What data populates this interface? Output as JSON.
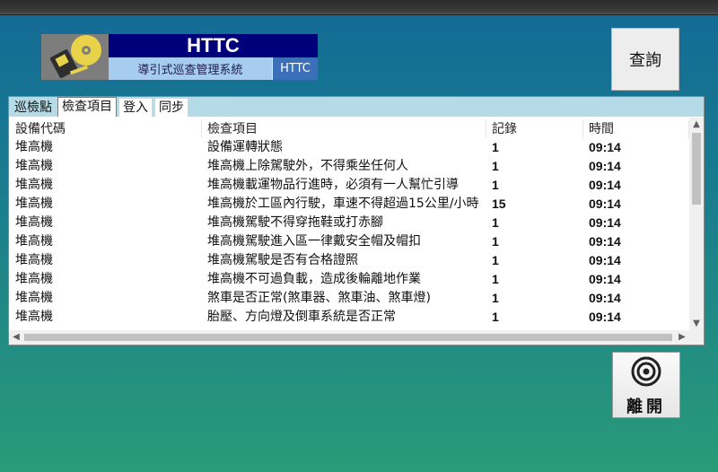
{
  "header": {
    "logo_title": "HTTC",
    "logo_subtitle": "導引式巡查管理系統",
    "logo_badge": "HTTC"
  },
  "buttons": {
    "query_label": "查詢",
    "leave_label": "離開"
  },
  "tabs": [
    {
      "label": "巡檢點"
    },
    {
      "label": "檢查項目"
    },
    {
      "label": "登入"
    },
    {
      "label": "同步"
    }
  ],
  "table": {
    "columns": [
      "設備代碼",
      "檢查項目",
      "記錄",
      "時間"
    ],
    "rows": [
      [
        "堆高機",
        "設備運轉狀態",
        "1",
        "09:14"
      ],
      [
        "堆高機",
        "堆高機上除駕駛外，不得乘坐任何人",
        "1",
        "09:14"
      ],
      [
        "堆高機",
        "堆高機載運物品行進時，必須有一人幫忙引導",
        "1",
        "09:14"
      ],
      [
        "堆高機",
        "堆高機於工區內行駛，車速不得超過15公里/小時",
        "15",
        "09:14"
      ],
      [
        "堆高機",
        "堆高機駕駛不得穿拖鞋或打赤腳",
        "1",
        "09:14"
      ],
      [
        "堆高機",
        "堆高機駕駛進入區一律戴安全帽及帽扣",
        "1",
        "09:14"
      ],
      [
        "堆高機",
        "堆高機駕駛是否有合格證照",
        "1",
        "09:14"
      ],
      [
        "堆高機",
        "堆高機不可過負載，造成後輪離地作業",
        "1",
        "09:14"
      ],
      [
        "堆高機",
        "煞車是否正常(煞車器、煞車油、煞車燈)",
        "1",
        "09:14"
      ],
      [
        "堆高機",
        "胎壓、方向燈及倒車系統是否正常",
        "1",
        "09:14"
      ]
    ]
  },
  "icons": {
    "logo": "cd-disc-icon",
    "leave": "target-icon"
  },
  "colors": {
    "logo_title_bg": "#00007a",
    "logo_sub_bg": "#a6cdf0",
    "logo_badge_bg": "#3b6fb8",
    "tab_strip": "#b5dbe8"
  }
}
